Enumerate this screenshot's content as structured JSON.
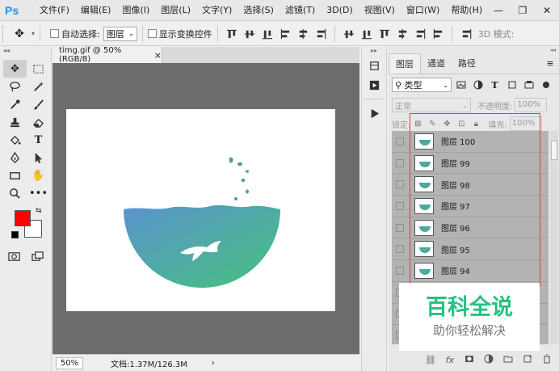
{
  "app": {
    "logo": "Ps"
  },
  "menu": [
    "文件(F)",
    "编辑(E)",
    "图像(I)",
    "图层(L)",
    "文字(Y)",
    "选择(S)",
    "滤镜(T)",
    "3D(D)",
    "视图(V)",
    "窗口(W)",
    "帮助(H)"
  ],
  "window_controls": {
    "minimize": "—",
    "restore": "❐",
    "close": "✕"
  },
  "options_bar": {
    "auto_select_label": "自动选择:",
    "auto_select_value": "图层",
    "transform_label": "显示变换控件",
    "mode_3d_label": "3D 模式:"
  },
  "toolbox": {
    "collapse": "◂◂",
    "swap": "⇆"
  },
  "document": {
    "tab_title": "timg.gif @ 50%(RGB/8)",
    "close": "×",
    "zoom": "50%",
    "doc_info": "文档:1.37M/126.3M",
    "status_arrow": "›"
  },
  "panel": {
    "tabs": [
      "图层",
      "通道",
      "路径"
    ],
    "active_tab": 0,
    "menu_icon": "≡",
    "filter_label": "⚲ 类型",
    "blend_mode": "正常",
    "opacity_label": "不透明度:",
    "opacity_value": "100%",
    "lock_label": "锁定:",
    "fill_label": "填充:",
    "fill_value": "100%",
    "layers": [
      "图层 100",
      "图层 99",
      "图层 98",
      "图层 97",
      "图层 96",
      "图层 95",
      "图层 94",
      "",
      "",
      "",
      ""
    ]
  },
  "watermark": {
    "title": "百科全说",
    "subtitle": "助你轻松解决"
  },
  "colors": {
    "foreground": "#ff0000",
    "background": "#ffffff",
    "accent": "#26c281",
    "highlight": "#e23b3b"
  }
}
